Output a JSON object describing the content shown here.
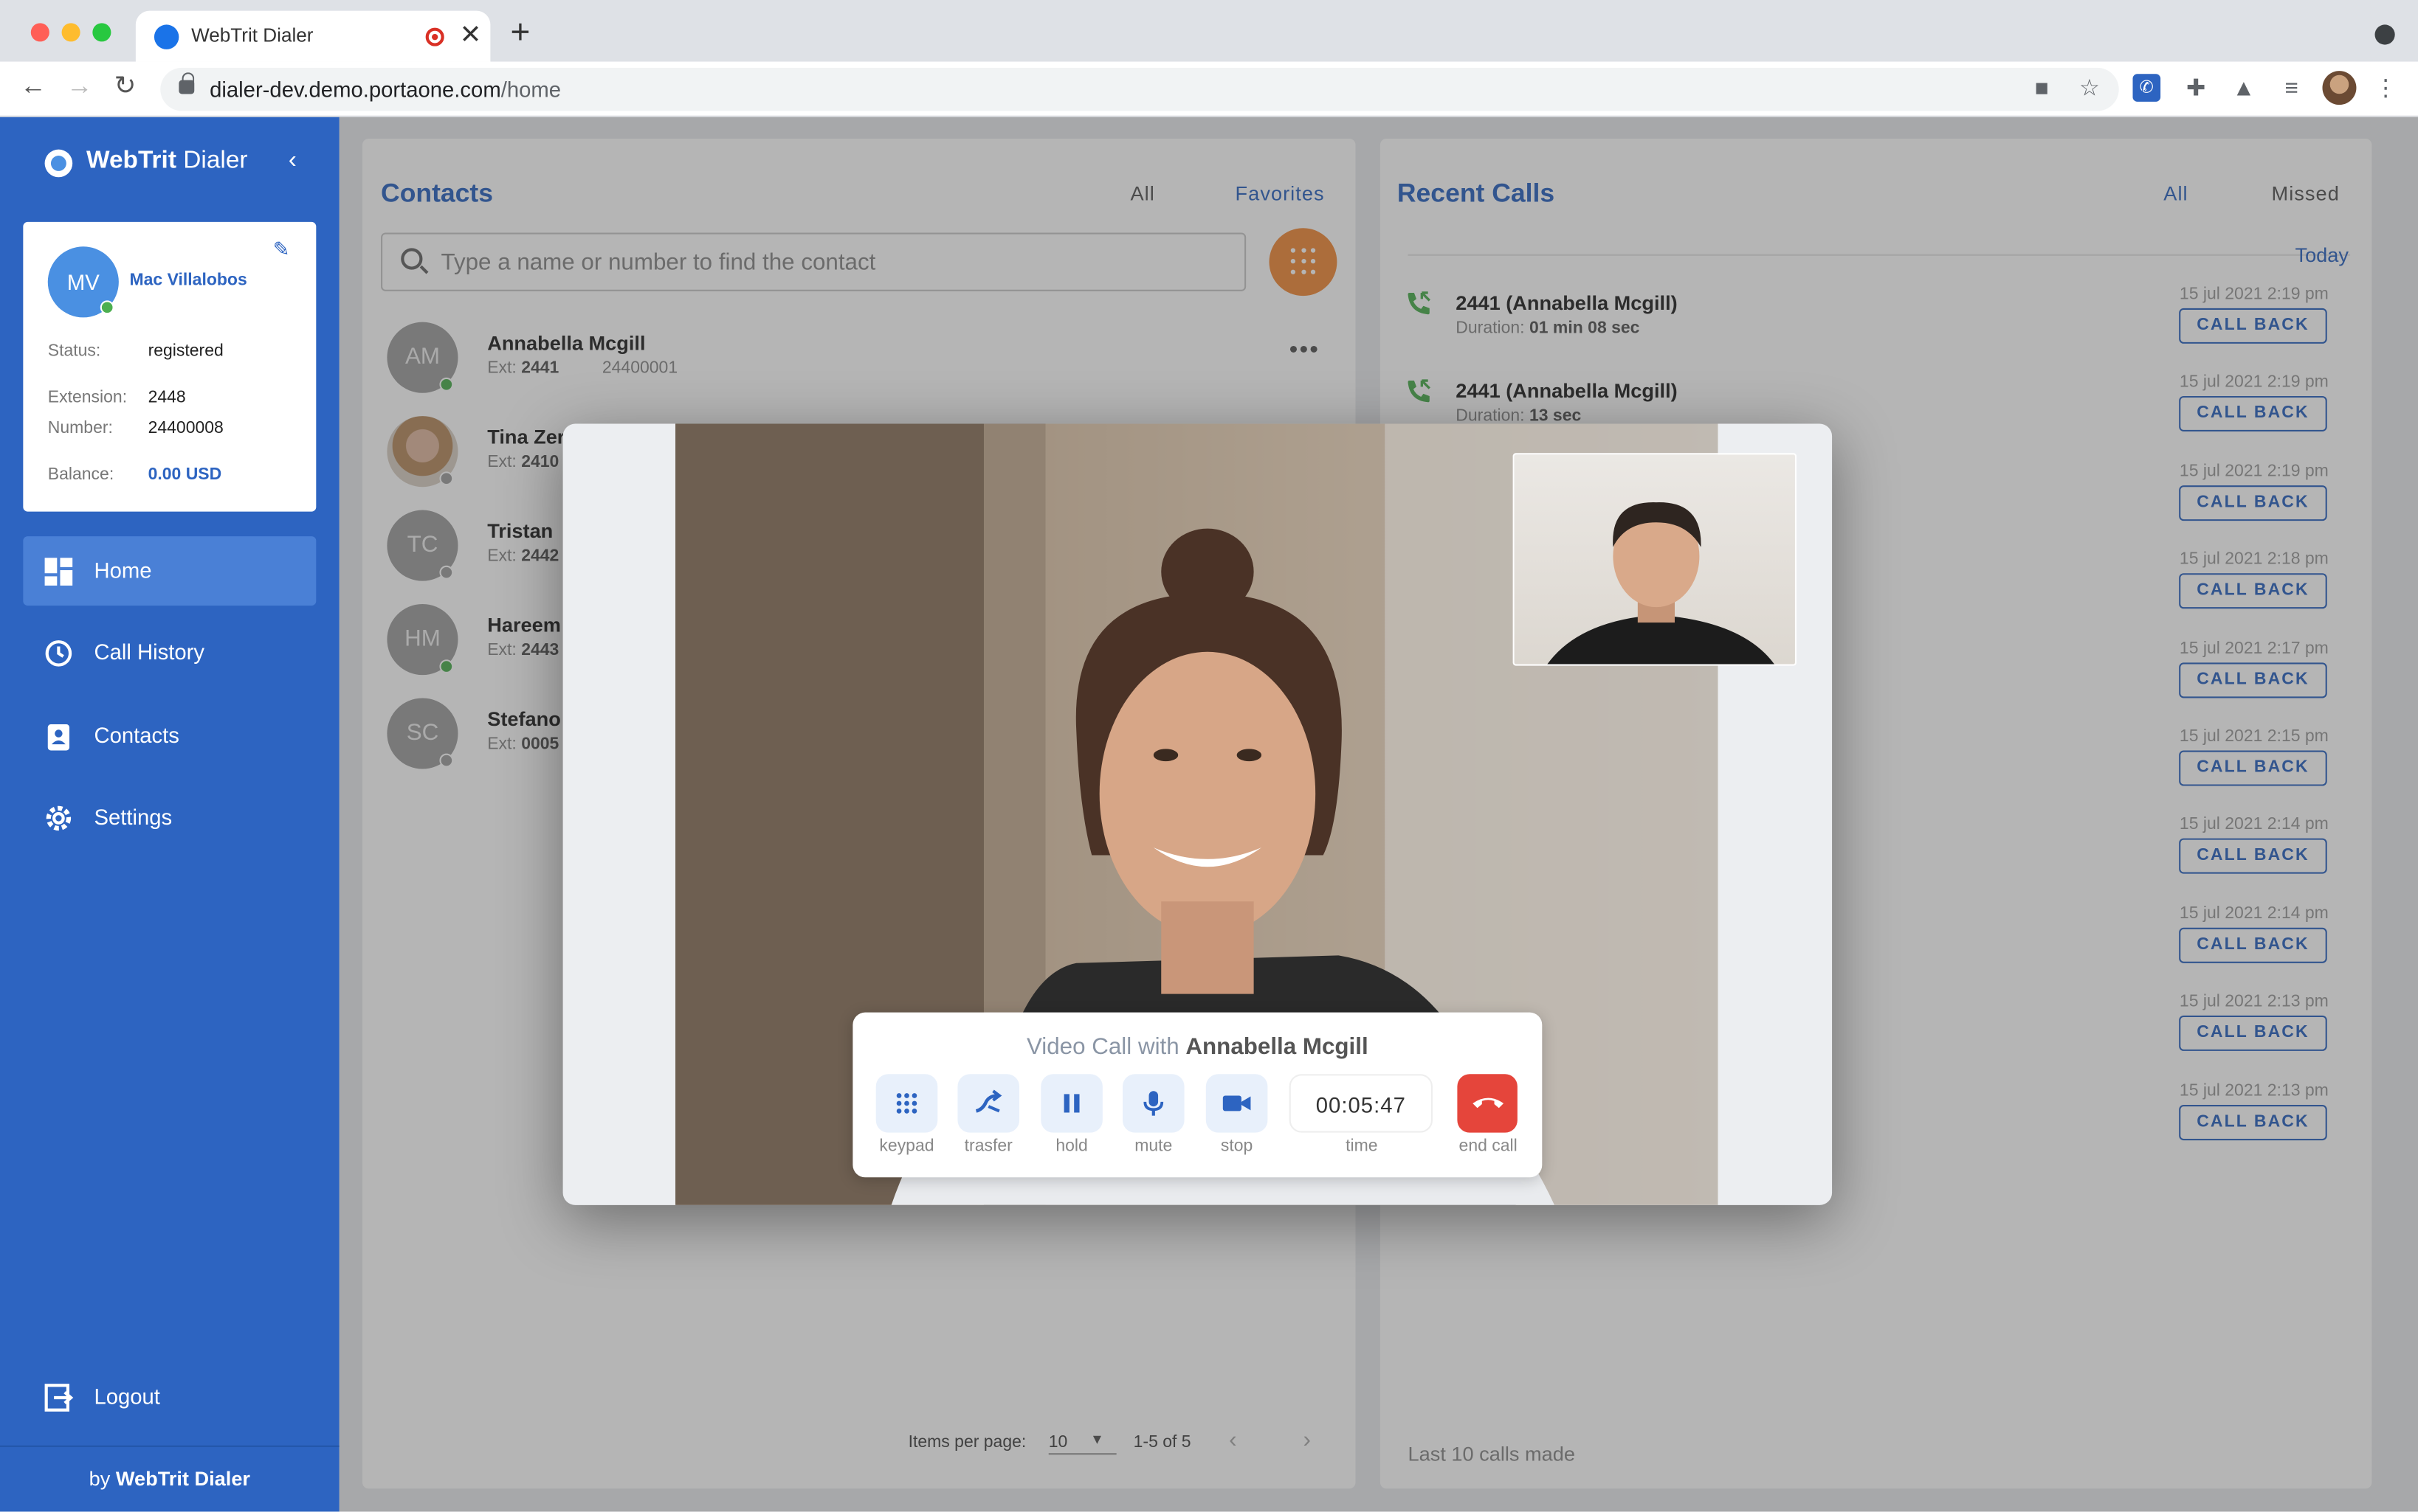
{
  "browser": {
    "tab_title": "WebTrit Dialer",
    "url_host": "dialer-dev.demo.portaone.com",
    "url_path": "/home"
  },
  "sidebar": {
    "logo_bold": "WebTrit",
    "logo_light": " Dialer",
    "user": {
      "initials": "MV",
      "name": "Mac Villalobos",
      "status_label": "Status:",
      "status_value": "registered",
      "extension_label": "Extension:",
      "extension_value": "2448",
      "number_label": "Number:",
      "number_value": "24400008",
      "balance_label": "Balance:",
      "balance_value": "0.00 USD"
    },
    "nav": [
      {
        "label": "Home",
        "active": true
      },
      {
        "label": "Call History"
      },
      {
        "label": "Contacts"
      },
      {
        "label": "Settings"
      }
    ],
    "logout": "Logout",
    "by_prefix": "by ",
    "by_brand": "WebTrit Dialer"
  },
  "contacts": {
    "title": "Contacts",
    "tab_all": "All",
    "tab_favorites": "Favorites",
    "search_placeholder": "Type a name or number to find the contact",
    "rows": [
      {
        "initials": "AM",
        "name": "Annabella Mcgill",
        "ext_label": "Ext:",
        "ext": "2441",
        "number": "24400001",
        "online": true
      },
      {
        "initials": "",
        "name": "Tina Zer",
        "ext_label": "Ext:",
        "ext": "2410",
        "number": "",
        "online": false
      },
      {
        "initials": "TC",
        "name": "Tristan",
        "ext_label": "Ext:",
        "ext": "2442",
        "number": "",
        "online": false
      },
      {
        "initials": "HM",
        "name": "Hareem",
        "ext_label": "Ext:",
        "ext": "2443",
        "number": "",
        "online": true
      },
      {
        "initials": "SC",
        "name": "Stefano",
        "ext_label": "Ext:",
        "ext": "0005",
        "number": "",
        "online": false
      }
    ],
    "pager": {
      "items_per_page_label": "Items per page:",
      "items_per_page": "10",
      "range": "1-5 of 5"
    }
  },
  "recent": {
    "title": "Recent Calls",
    "tab_all": "All",
    "tab_missed": "Missed",
    "group_label": "Today",
    "calls": [
      {
        "name": "2441 (Annabella Mcgill)",
        "duration_label": "Duration:",
        "duration": "01 min 08 sec",
        "time": "15 jul 2021 2:19 pm"
      },
      {
        "name": "2441 (Annabella Mcgill)",
        "duration_label": "Duration:",
        "duration": "13 sec",
        "time": "15 jul 2021 2:19 pm"
      },
      {
        "time": "15 jul 2021 2:19 pm"
      },
      {
        "time": "15 jul 2021 2:18 pm"
      },
      {
        "time": "15 jul 2021 2:17 pm"
      },
      {
        "time": "15 jul 2021 2:15 pm"
      },
      {
        "time": "15 jul 2021 2:14 pm"
      },
      {
        "time": "15 jul 2021 2:14 pm"
      },
      {
        "time": "15 jul 2021 2:13 pm"
      },
      {
        "time": "15 jul 2021 2:13 pm"
      }
    ],
    "callback_label": "CALL BACK",
    "footer": "Last 10 calls made"
  },
  "video_call": {
    "title_prefix": "Video Call with ",
    "peer": "Annabella Mcgill",
    "controls": {
      "keypad": "keypad",
      "transfer": "trasfer",
      "hold": "hold",
      "mute": "mute",
      "stop": "stop",
      "time": "time",
      "end": "end call"
    },
    "elapsed": "00:05:47"
  },
  "colors": {
    "primary": "#2d64c1",
    "accent_orange": "#f18b3b",
    "end_call_red": "#e5453b",
    "online_green": "#4caf50"
  }
}
